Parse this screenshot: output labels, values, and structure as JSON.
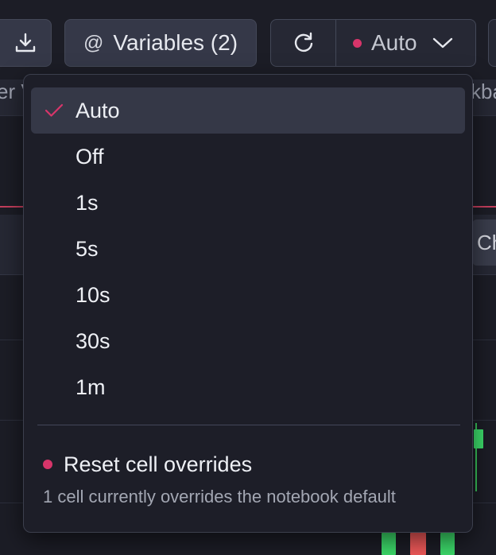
{
  "toolbar": {
    "download_icon": "download-icon",
    "variables_prefix": "@",
    "variables_label": "Variables (2)",
    "refresh_icon": "refresh-icon",
    "interval_label": "Auto",
    "chevron_icon": "chevron-down-icon",
    "accent_color": "#d7356a"
  },
  "background": {
    "peek_left": "er V",
    "peek_right": "kba",
    "cell_tab_label": "Ch",
    "candle_colors": {
      "up": "#3ddc6b",
      "down": "#f25a5a"
    }
  },
  "dropdown": {
    "options": [
      {
        "label": "Auto",
        "selected": true
      },
      {
        "label": "Off",
        "selected": false
      },
      {
        "label": "1s",
        "selected": false
      },
      {
        "label": "5s",
        "selected": false
      },
      {
        "label": "10s",
        "selected": false
      },
      {
        "label": "30s",
        "selected": false
      },
      {
        "label": "1m",
        "selected": false
      }
    ],
    "check_icon": "check-icon",
    "reset_label": "Reset cell overrides",
    "reset_description": "1 cell currently overrides the notebook default"
  }
}
